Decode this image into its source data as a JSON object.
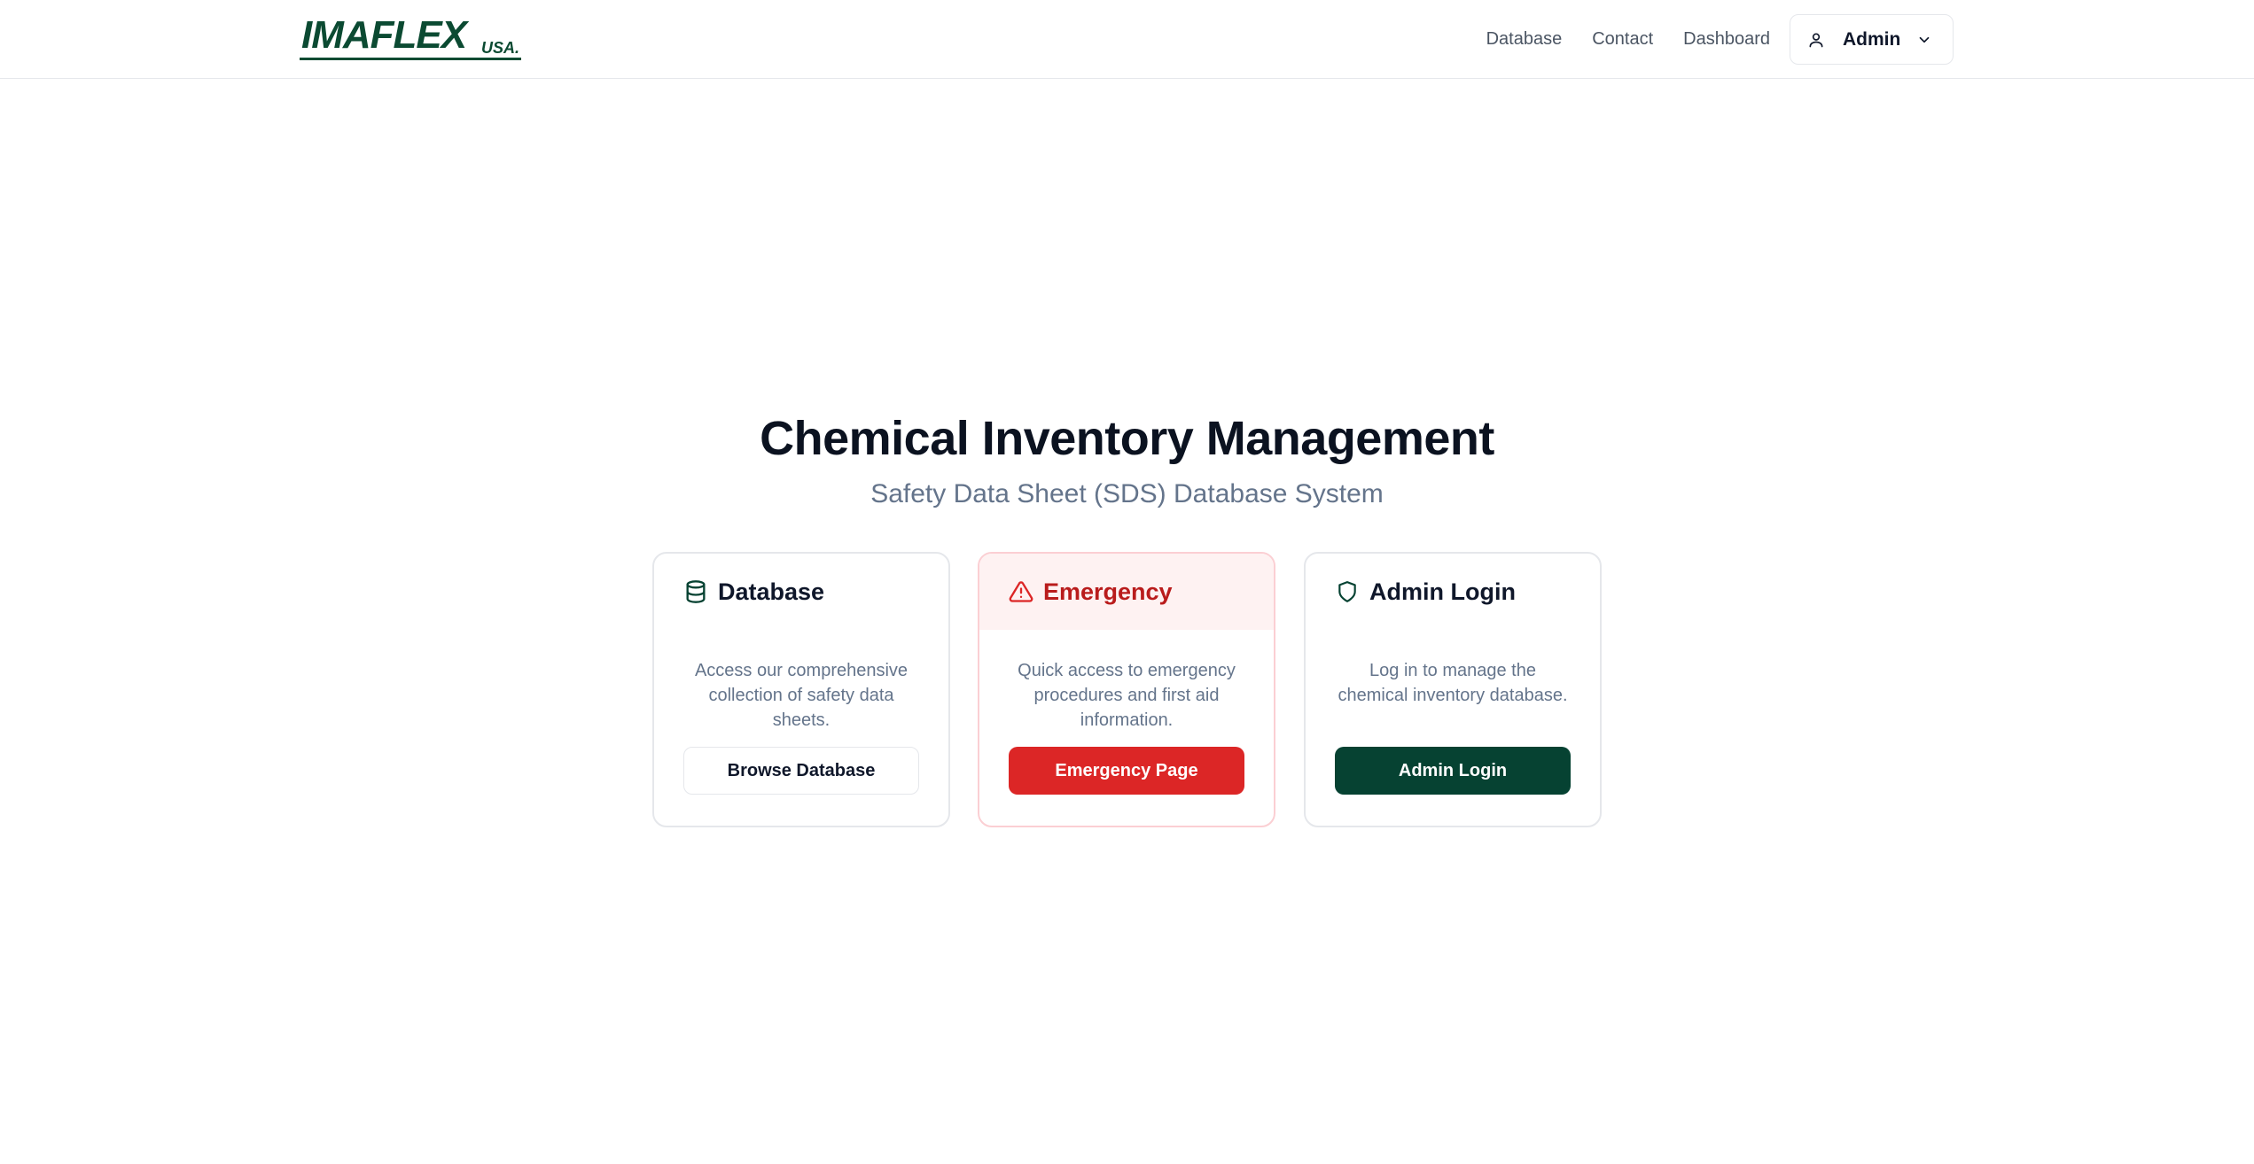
{
  "header": {
    "logo": {
      "main": "IMAFLEX",
      "suffix": "USA."
    },
    "nav": [
      {
        "label": "Database"
      },
      {
        "label": "Contact"
      },
      {
        "label": "Dashboard"
      }
    ],
    "user_menu": {
      "label": "Admin",
      "icon": "user-icon",
      "chevron": "chevron-down-icon"
    }
  },
  "hero": {
    "title": "Chemical Inventory Management",
    "subtitle": "Safety Data Sheet (SDS) Database System"
  },
  "cards": [
    {
      "icon": "database-icon",
      "title": "Database",
      "description": "Access our comprehensive collection of safety data sheets.",
      "button": "Browse Database"
    },
    {
      "icon": "alert-triangle-icon",
      "title": "Emergency",
      "description": "Quick access to emergency procedures and first aid information.",
      "button": "Emergency Page"
    },
    {
      "icon": "shield-icon",
      "title": "Admin Login",
      "description": "Log in to manage the chemical inventory database.",
      "button": "Admin Login"
    }
  ],
  "colors": {
    "brand_green": "#064232",
    "emergency_red": "#dc2626",
    "emergency_bg": "#fef2f2"
  }
}
